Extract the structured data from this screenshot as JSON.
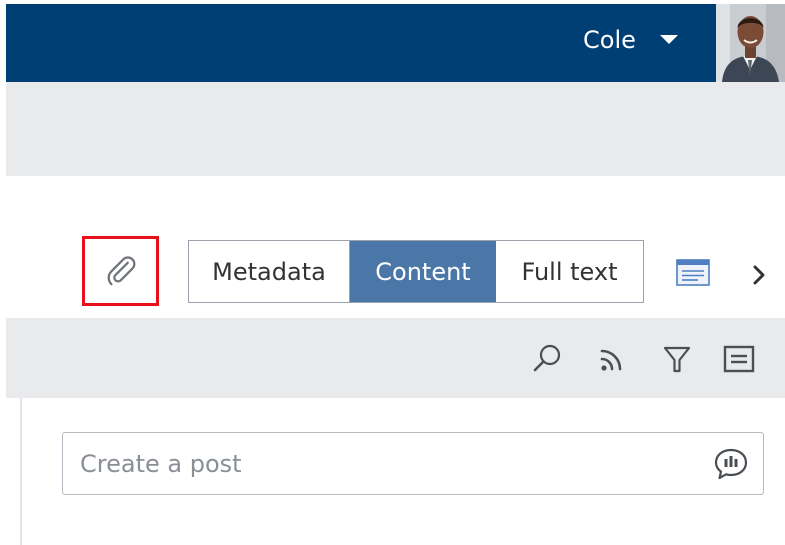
{
  "header": {
    "user_name": "Cole",
    "user_menu_icon": "caret-down-icon",
    "avatar": "user-avatar-photo"
  },
  "document_tabs": {
    "attachment_icon": "paperclip-icon",
    "tabs": [
      {
        "label": "Metadata",
        "selected": false
      },
      {
        "label": "Content",
        "selected": true
      },
      {
        "label": "Full text",
        "selected": false
      }
    ],
    "view_icon": "preview-card-icon",
    "next_icon": "chevron-right-icon"
  },
  "feed_toolbar": {
    "icons": [
      "search-icon",
      "rss-feed-icon",
      "filter-icon",
      "list-view-icon"
    ]
  },
  "post": {
    "placeholder": "Create a post",
    "icon": "speech-bubble-icon"
  },
  "colors": {
    "header_bg": "#003f74",
    "tab_selected_bg": "#4b77a8",
    "highlight_border": "#e8101a",
    "panel_bg": "#e9eaec"
  }
}
